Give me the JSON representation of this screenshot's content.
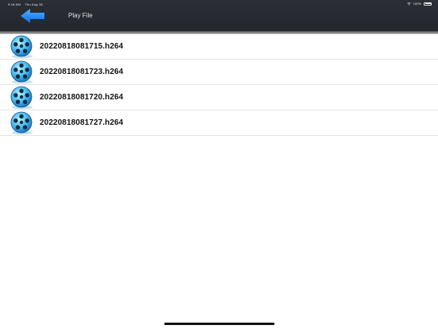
{
  "status_bar": {
    "time": "9:18 AM",
    "date": "Thu Aug 18",
    "battery": "100%"
  },
  "header": {
    "title": "Play File",
    "back_icon": "arrow-left-icon",
    "accent": "#1e88e5"
  },
  "files": [
    {
      "name": "20220818081715.h264",
      "icon": "film-reel-icon"
    },
    {
      "name": "20220818081723.h264",
      "icon": "film-reel-icon"
    },
    {
      "name": "20220818081720.h264",
      "icon": "film-reel-icon"
    },
    {
      "name": "20220818081727.h264",
      "icon": "film-reel-icon"
    }
  ]
}
